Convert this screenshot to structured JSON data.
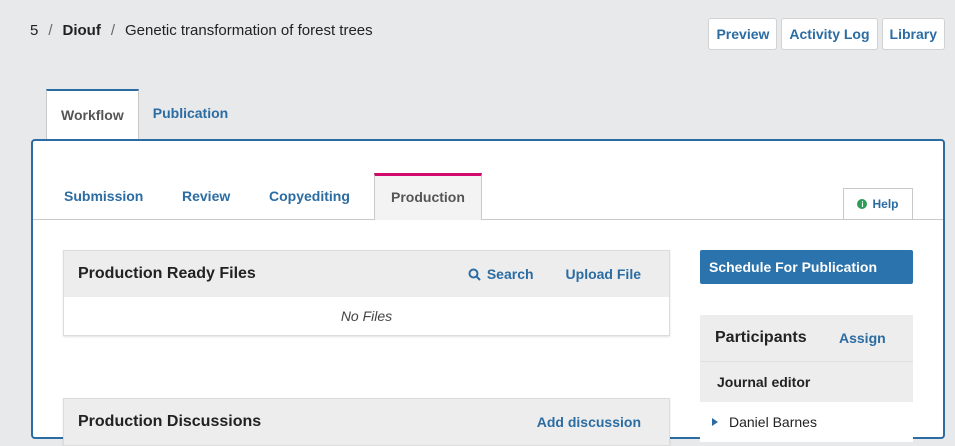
{
  "breadcrumb": {
    "id": "5",
    "author": "Diouf",
    "title": "Genetic transformation of forest trees"
  },
  "top_actions": [
    "Preview",
    "Activity Log",
    "Library"
  ],
  "page_tabs": [
    "Workflow",
    "Publication"
  ],
  "stage_tabs": [
    "Submission",
    "Review",
    "Copyediting",
    "Production"
  ],
  "help": "Help",
  "production_ready_files": {
    "title": "Production Ready Files",
    "search": "Search",
    "upload": "Upload File",
    "empty": "No Files"
  },
  "production_discussions": {
    "title": "Production Discussions",
    "add": "Add discussion"
  },
  "schedule_button": "Schedule For Publication",
  "participants": {
    "title": "Participants",
    "assign": "Assign",
    "role": "Journal editor",
    "person": "Daniel Barnes"
  },
  "colors": {
    "link": "#2b6ca3",
    "primary_button": "#2b73ad",
    "active_stage_accent": "#d00a6c",
    "help_icon": "#2e9c5a"
  }
}
